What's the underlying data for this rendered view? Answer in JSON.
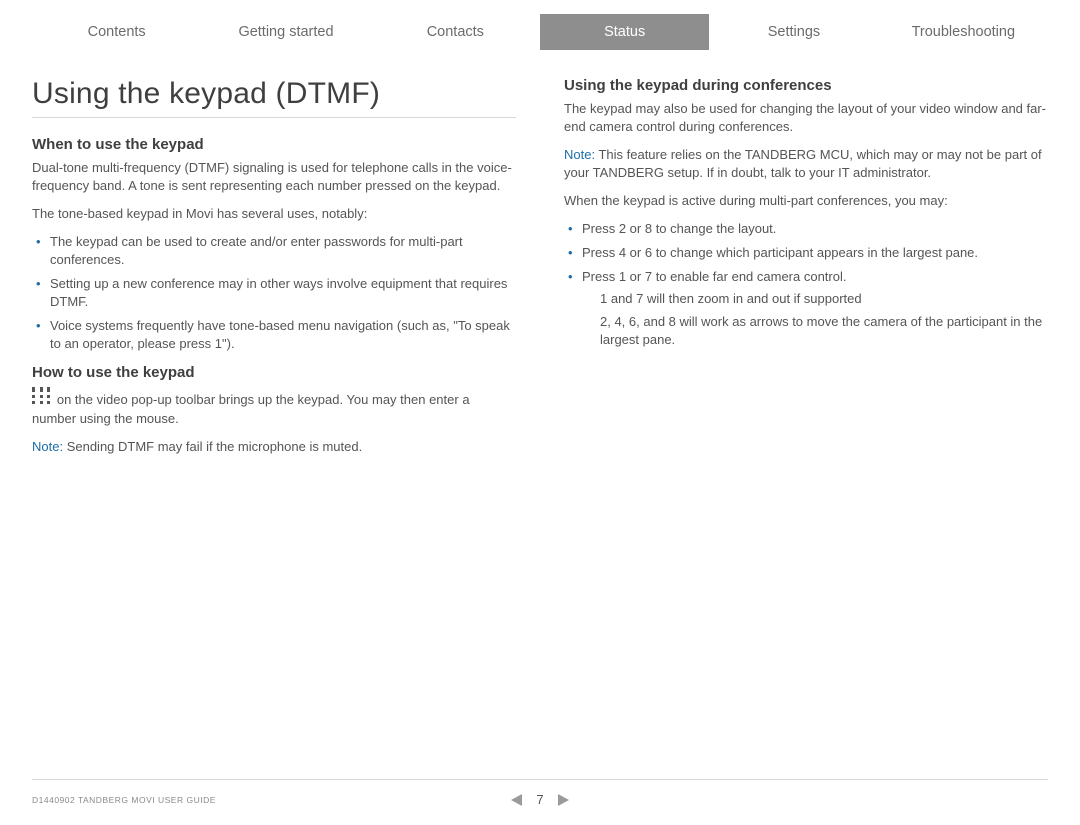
{
  "tabs": [
    {
      "label": "Contents"
    },
    {
      "label": "Getting started"
    },
    {
      "label": "Contacts"
    },
    {
      "label": "Status",
      "active": true
    },
    {
      "label": "Settings"
    },
    {
      "label": "Troubleshooting"
    }
  ],
  "title": "Using the keypad (DTMF)",
  "left": {
    "s1": {
      "heading": "When to use the keypad",
      "p1": "Dual-tone multi-frequency (DTMF) signaling is used for telephone calls in the voice-frequency band. A tone is sent representing each number pressed on the keypad.",
      "p2": "The tone-based keypad in Movi has several uses, notably:",
      "b1": "The keypad can be used to create and/or enter passwords for multi-part conferences.",
      "b2": "Setting up a new conference may in other ways involve equipment that requires DTMF.",
      "b3": "Voice systems frequently have tone-based menu navigation (such as, \"To speak to an operator, please press 1\")."
    },
    "s2": {
      "heading": "How to use the keypad",
      "p1": " on the video pop-up toolbar brings up the keypad. You may then enter a number using the mouse.",
      "note_label": "Note:",
      "note_body": " Sending DTMF may fail if the microphone is muted."
    }
  },
  "right": {
    "heading": "Using the keypad during conferences",
    "p1": "The keypad may also be used for changing the layout of your video window and far-end camera control during conferences.",
    "note_label": "Note:",
    "note_body": " This feature relies on the TANDBERG MCU, which may or may not be part of your TANDBERG setup. If in doubt, talk to your IT administrator.",
    "p2": "When the keypad is active during multi-part conferences, you may:",
    "b1": "Press 2 or 8 to change the layout.",
    "b2": "Press 4 or 6 to change which participant appears in the largest pane.",
    "b3": "Press 1 or 7 to enable far end camera control.",
    "sub1": "1 and 7 will then zoom in and out if supported",
    "sub2": "2, 4, 6, and 8 will work as arrows to move the camera of the participant in the largest pane."
  },
  "footer": {
    "doc": "D1440902 TANDBERG MOVI USER GUIDE",
    "page": "7"
  }
}
